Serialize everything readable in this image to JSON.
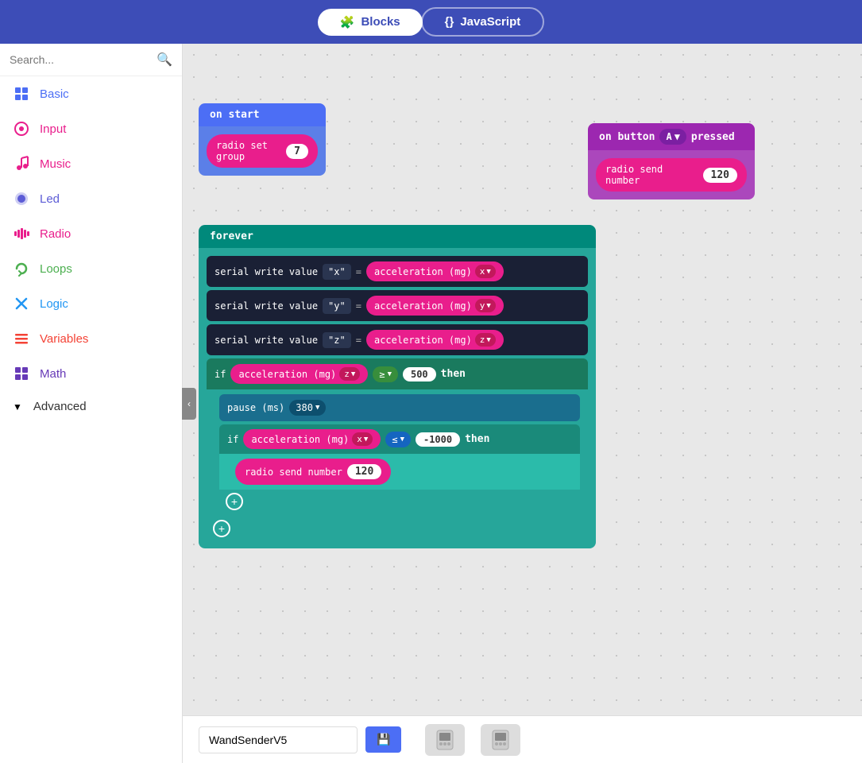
{
  "header": {
    "blocks_label": "Blocks",
    "js_label": "JavaScript"
  },
  "sidebar": {
    "search_placeholder": "Search...",
    "items": [
      {
        "id": "basic",
        "label": "Basic",
        "icon": "⊞",
        "color": "#4c6ef5"
      },
      {
        "id": "input",
        "label": "Input",
        "icon": "◎",
        "color": "#e91e8c"
      },
      {
        "id": "music",
        "label": "Music",
        "icon": "♪",
        "color": "#e91e8c"
      },
      {
        "id": "led",
        "label": "Led",
        "icon": "◑",
        "color": "#5c5cd6"
      },
      {
        "id": "radio",
        "label": "Radio",
        "icon": "⊪",
        "color": "#e91e8c"
      },
      {
        "id": "loops",
        "label": "Loops",
        "icon": "↺",
        "color": "#4caf50"
      },
      {
        "id": "logic",
        "label": "Logic",
        "icon": "✕",
        "color": "#2196f3"
      },
      {
        "id": "variables",
        "label": "Variables",
        "icon": "≡",
        "color": "#f44336"
      },
      {
        "id": "math",
        "label": "Math",
        "icon": "⊞",
        "color": "#673ab7"
      },
      {
        "id": "advanced",
        "label": "Advanced",
        "icon": "▼",
        "color": "#333"
      }
    ]
  },
  "blocks": {
    "on_start_label": "on start",
    "radio_set_group_label": "radio set group",
    "radio_set_group_value": "7",
    "on_button_label": "on button",
    "button_a": "A",
    "pressed_label": "pressed",
    "radio_send_number_label": "radio send number",
    "radio_send_number_value": "120",
    "forever_label": "forever",
    "serial_write_x": "serial write value",
    "str_x": "\"x\"",
    "str_y": "\"y\"",
    "str_z": "\"z\"",
    "equals": "=",
    "accel_mg": "acceleration (mg)",
    "accel_x": "x",
    "accel_y": "y",
    "accel_z": "z",
    "if_label": "if",
    "ge_op": "≥",
    "threshold_500": "500",
    "then_label": "then",
    "pause_ms_label": "pause (ms)",
    "pause_value": "380",
    "le_op": "≤",
    "threshold_neg1000": "-1000",
    "radio_send_inner_value": "120"
  },
  "bottom_bar": {
    "project_name": "WandSenderV5",
    "save_icon": "💾"
  }
}
